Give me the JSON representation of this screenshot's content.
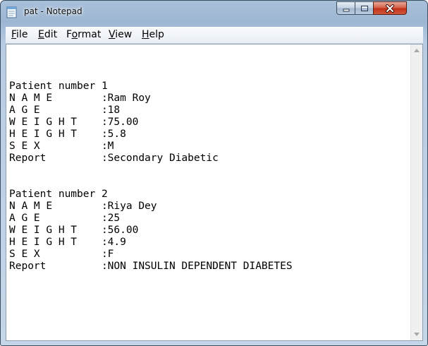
{
  "window": {
    "title": "pat - Notepad",
    "app_icon": "notepad-icon"
  },
  "titlebar_buttons": {
    "minimize": "minimize-icon",
    "maximize": "maximize-icon",
    "close": "close-icon"
  },
  "menu": {
    "file": {
      "mnemonic": "F",
      "rest": "ile"
    },
    "edit": {
      "mnemonic": "E",
      "rest": "dit"
    },
    "format": {
      "mnemonic": "o",
      "pre": "F",
      "rest": "rmat"
    },
    "view": {
      "mnemonic": "V",
      "rest": "iew"
    },
    "help": {
      "mnemonic": "H",
      "rest": "elp"
    }
  },
  "document": {
    "lines": [
      "Patient number 1",
      "N A M E        :Ram Roy",
      "A G E          :18",
      "W E I G H T    :75.00",
      "H E I G H T    :5.8",
      "S E X          :M",
      "Report         :Secondary Diabetic",
      "",
      "",
      "Patient number 2",
      "N A M E        :Riya Dey",
      "A G E          :25",
      "W E I G H T    :56.00",
      "H E I G H T    :4.9",
      "S E X          :F",
      "Report         :NON INSULIN DEPENDENT DIABETES"
    ]
  },
  "scrollbar": {
    "up": "scroll-up-arrow-icon",
    "down": "scroll-down-arrow-icon"
  }
}
